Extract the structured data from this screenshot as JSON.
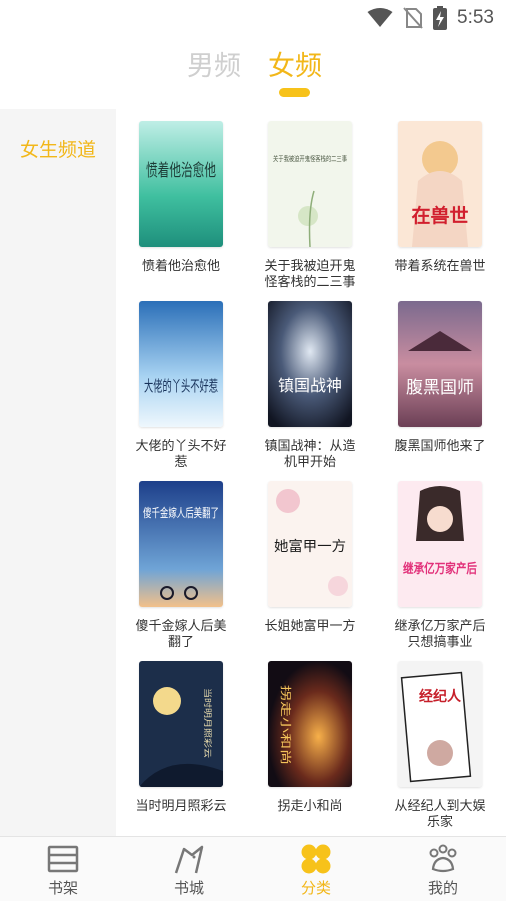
{
  "status_bar": {
    "time": "5:53"
  },
  "gender_tabs": [
    {
      "label": "男频",
      "active": false
    },
    {
      "label": "女频",
      "active": true
    }
  ],
  "accent_color": "#f2b719",
  "sidebar": {
    "items": [
      {
        "label": "女生频道",
        "active": true
      }
    ]
  },
  "books": [
    {
      "title": "愤着他治愈他",
      "cover_text": "愤着他治愈他"
    },
    {
      "title": "关于我被迫开鬼怪客栈的二三事",
      "cover_text": "关于我被迫开鬼怪客栈的二三事"
    },
    {
      "title": "带着系统在兽世",
      "cover_text": "在兽世"
    },
    {
      "title": "大佬的丫头不好惹",
      "cover_text": "大佬的丫头不好惹"
    },
    {
      "title": "镇国战神：从造机甲开始",
      "cover_text": "镇国战神"
    },
    {
      "title": "腹黑国师他来了",
      "cover_text": "腹黑国师"
    },
    {
      "title": "傻千金嫁人后美翻了",
      "cover_text": "傻千金嫁人后美翻了"
    },
    {
      "title": "长姐她富甲一方",
      "cover_text": "她富甲一方"
    },
    {
      "title": "继承亿万家产后只想搞事业",
      "cover_text": "继承亿万家产后"
    },
    {
      "title": "当时明月照彩云",
      "cover_text": "当时明月照彩云"
    },
    {
      "title": "拐走小和尚",
      "cover_text": "拐走小和尚"
    },
    {
      "title": "从经纪人到大娱乐家",
      "cover_text": "经纪人"
    }
  ],
  "bottom_nav": [
    {
      "label": "书架",
      "icon": "bookshelf-icon",
      "active": false
    },
    {
      "label": "书城",
      "icon": "bookstore-icon",
      "active": false
    },
    {
      "label": "分类",
      "icon": "category-clover-icon",
      "active": true
    },
    {
      "label": "我的",
      "icon": "paw-profile-icon",
      "active": false
    }
  ]
}
